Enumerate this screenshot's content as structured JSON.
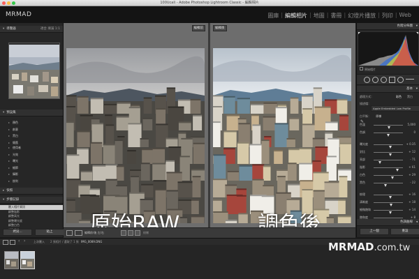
{
  "window": {
    "title": "100Ucali - Adobe Photoshop Lightroom Classic - 編輯相片"
  },
  "brand": "MRMAD",
  "modules": [
    "圖庫",
    "編輯相片",
    "地圖",
    "書冊",
    "幻燈片播放",
    "列印",
    "Web"
  ],
  "active_module": "編輯相片",
  "left_panel": {
    "navigator": {
      "title": "導覽器",
      "options": "適合 填滿 1:1"
    },
    "presets": {
      "title": "預設集",
      "items": [
        "顏色",
        "創意",
        "黑白",
        "懷舊"
      ]
    },
    "user_presets": [
      "使用者",
      "光效",
      "曝光",
      "細節",
      "攝影",
      "銳利"
    ],
    "snapshots": {
      "title": "快照"
    },
    "history": {
      "title": "步驟記錄",
      "items": [
        "匯入相片資訊",
        "調整陰影",
        "調整高光",
        "調整曝光度",
        "調整白色",
        "調整黑色"
      ]
    },
    "collections": {
      "title": "集合"
    },
    "copy_button": "拷貝...",
    "paste_button": "貼上"
  },
  "center": {
    "left_tag": "編輯前",
    "right_tag": "編輯後",
    "left_label": "原始RAW",
    "right_label": "調色後"
  },
  "toolbar": {
    "mode_text": "編輯前/後 左/右",
    "soft_proof": "校樣"
  },
  "right_panel": {
    "histogram_title": "色階分佈圖",
    "original_photo": "原始相片",
    "basic_title": "基本",
    "treatment_label": "處理方式：",
    "treatment_color": "彩色",
    "treatment_bw": "黑白",
    "profile_label": "描述檔：",
    "profile_value": "Apple Embedded Low Profile",
    "wb_label": "白平衡：",
    "wb_value": "原樣",
    "sliders": [
      {
        "label": "色溫",
        "value": "5,000",
        "pos": 0.52
      },
      {
        "label": "色調",
        "value": "0",
        "pos": 0.5
      },
      {
        "label": "曝光度",
        "value": "+ 0.35",
        "pos": 0.56
      },
      {
        "label": "對比",
        "value": "+ 12",
        "pos": 0.56
      },
      {
        "label": "亮部",
        "value": "- 71",
        "pos": 0.22
      },
      {
        "label": "陰影",
        "value": "+ 61",
        "pos": 0.8
      },
      {
        "label": "白色",
        "value": "+ 29",
        "pos": 0.64
      },
      {
        "label": "黑色",
        "value": "- 22",
        "pos": 0.4
      },
      {
        "label": "紋理",
        "value": "+ 16",
        "pos": 0.58
      },
      {
        "label": "清晰度",
        "value": "+ 18",
        "pos": 0.59
      },
      {
        "label": "細微飽和",
        "value": "+ 14",
        "pos": 0.57
      },
      {
        "label": "飽和度",
        "value": "+ 8",
        "pos": 0.54
      }
    ],
    "tone_curve_title": "色調曲線",
    "prev_button": "上一個",
    "reset_button": "重設"
  },
  "filmstrip": {
    "source": "上次匯入",
    "info": "2 張相片 / 選取了 1 張",
    "filename": "IMG_0089.DNG"
  },
  "watermark": {
    "brand": "MRMAD",
    "domain": ".com.tw"
  }
}
